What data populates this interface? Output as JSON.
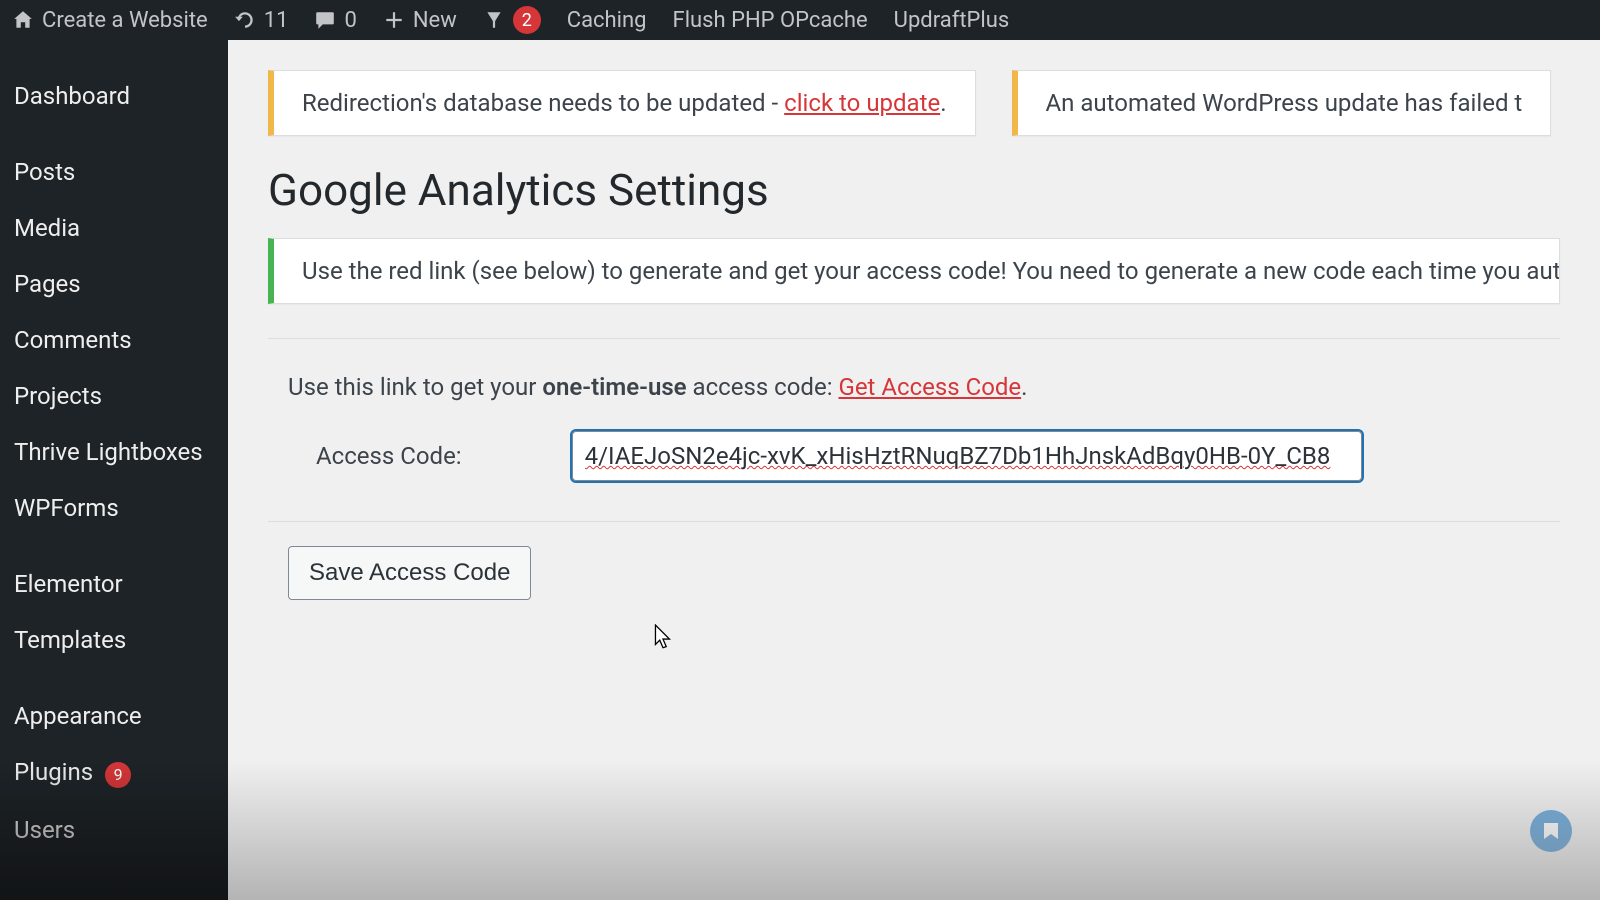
{
  "adminbar": {
    "site_label": "Create a Website",
    "updates_count": "11",
    "comments_count": "0",
    "new_label": "New",
    "yoast_count": "2",
    "caching_label": "Caching",
    "flush_label": "Flush PHP OPcache",
    "updraft_label": "UpdraftPlus"
  },
  "sidebar": {
    "items": [
      "Dashboard",
      "Posts",
      "Media",
      "Pages",
      "Comments",
      "Projects",
      "Thrive Lightboxes",
      "WPForms",
      "Elementor",
      "Templates",
      "Appearance",
      "Plugins",
      "Users"
    ],
    "plugins_badge": "9"
  },
  "notices": {
    "redirection_prefix": "Redirection's database needs to be updated - ",
    "redirection_link": "click to update",
    "wp_update": "An automated WordPress update has failed t"
  },
  "page": {
    "title": "Google Analytics Settings",
    "instruction": "Use the red link (see below) to generate and get your access code! You need to generate a new code each time you authorize",
    "lead_prefix": "Use this link to get your ",
    "lead_bold": "one-time-use",
    "lead_suffix": " access code: ",
    "get_code_link": "Get Access Code",
    "access_code_label": "Access Code:",
    "access_code_value": "4/IAEJoSN2e4jc-xvK_xHisHztRNuqBZ7Db1HhJnskAdBqy0HB-0Y_CB8",
    "save_button": "Save Access Code"
  }
}
